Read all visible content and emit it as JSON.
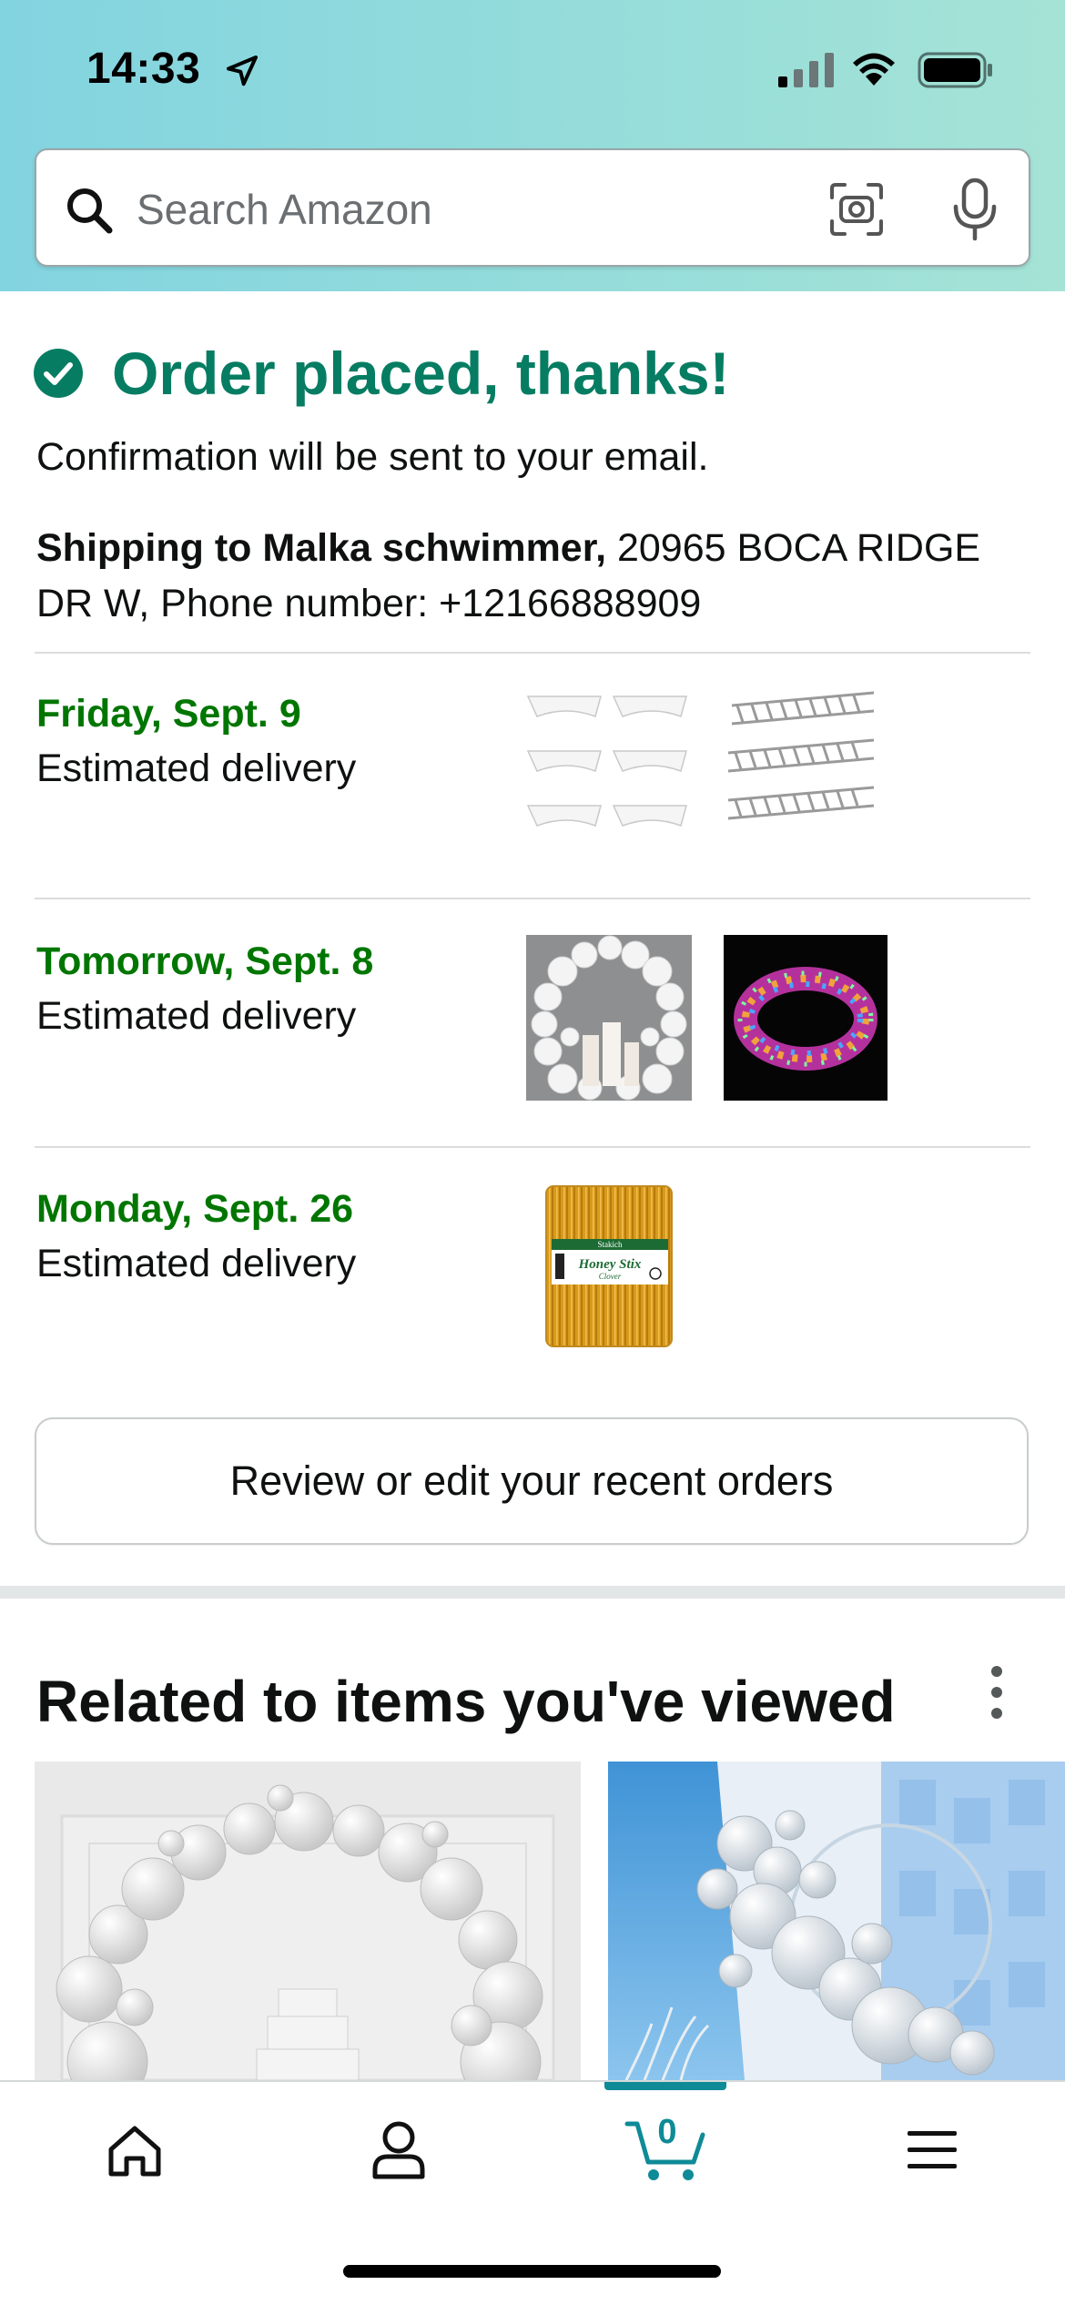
{
  "status_bar": {
    "time": "14:33"
  },
  "search": {
    "placeholder": "Search Amazon"
  },
  "confirmation": {
    "title": "Order placed, thanks!",
    "subtitle": "Confirmation will be sent to your email.",
    "shipping_bold": "Shipping to Malka schwimmer,",
    "shipping_rest": " 20965 BOCA RIDGE DR W, Phone number: +12166888909"
  },
  "deliveries": [
    {
      "date": "Friday, Sept. 9",
      "label": "Estimated delivery"
    },
    {
      "date": "Tomorrow, Sept. 8",
      "label": "Estimated delivery"
    },
    {
      "date": "Monday, Sept. 26",
      "label": "Estimated delivery"
    }
  ],
  "product_thumbs": {
    "honey_brand": "Stakich",
    "honey_name": "Honey Stix",
    "honey_flavor": "Clover"
  },
  "review_button": {
    "label": "Review or edit your recent orders"
  },
  "related": {
    "title": "Related to items you've viewed"
  },
  "bottom_nav": {
    "items": [
      {
        "name": "home",
        "icon": "home-icon"
      },
      {
        "name": "account",
        "icon": "person-icon"
      },
      {
        "name": "cart",
        "icon": "cart-icon",
        "count": "0"
      },
      {
        "name": "menu",
        "icon": "hamburger-menu-icon"
      }
    ],
    "active": "cart"
  },
  "colors": {
    "success_green": "#067d62",
    "delivery_green": "#007600",
    "accent_teal": "#0e8b96",
    "header_gradient": [
      "#82d4e0",
      "#a5e3d6"
    ]
  }
}
